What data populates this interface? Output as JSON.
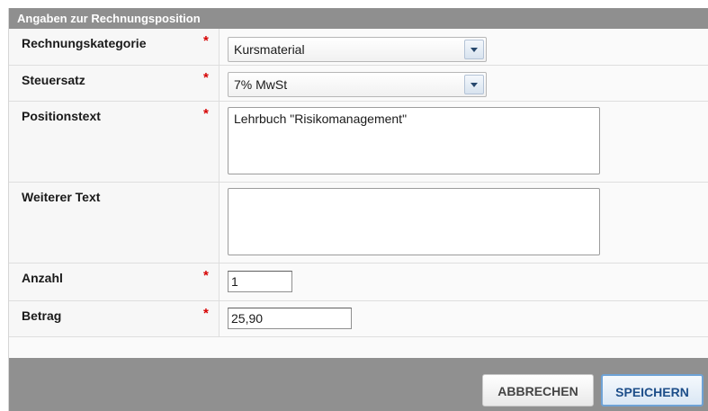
{
  "dialog": {
    "title": "Angaben zur Rechnungsposition"
  },
  "required_marker": "*",
  "fields": {
    "kategorie": {
      "label": "Rechnungskategorie",
      "value": "Kursmaterial",
      "required": true
    },
    "steuersatz": {
      "label": "Steuersatz",
      "value": "7% MwSt",
      "required": true
    },
    "positionstext": {
      "label": "Positionstext",
      "value": "Lehrbuch \"Risikomanagement\"",
      "required": true
    },
    "weiterer_text": {
      "label": "Weiterer Text",
      "value": "",
      "required": false
    },
    "anzahl": {
      "label": "Anzahl",
      "value": "1",
      "required": true
    },
    "betrag": {
      "label": "Betrag",
      "value": "25,90",
      "required": true
    }
  },
  "buttons": {
    "cancel": "ABBRECHEN",
    "save": "SPEICHERN"
  },
  "colors": {
    "titlebar": "#8f8f8f",
    "required": "#d60000",
    "save_border": "#6ea2d6",
    "save_text": "#1d4e89"
  }
}
